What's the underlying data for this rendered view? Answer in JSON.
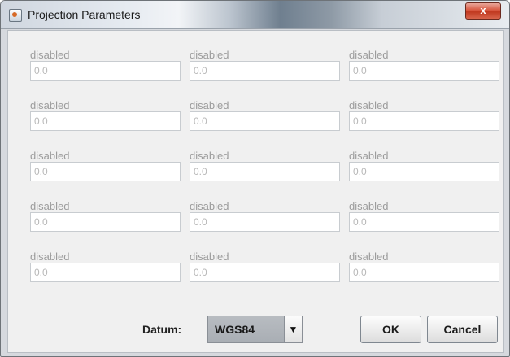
{
  "window": {
    "title": "Projection Parameters",
    "close_label": "x"
  },
  "fields": [
    {
      "label": "disabled",
      "value": "0.0"
    },
    {
      "label": "disabled",
      "value": "0.0"
    },
    {
      "label": "disabled",
      "value": "0.0"
    },
    {
      "label": "disabled",
      "value": "0.0"
    },
    {
      "label": "disabled",
      "value": "0.0"
    },
    {
      "label": "disabled",
      "value": "0.0"
    },
    {
      "label": "disabled",
      "value": "0.0"
    },
    {
      "label": "disabled",
      "value": "0.0"
    },
    {
      "label": "disabled",
      "value": "0.0"
    },
    {
      "label": "disabled",
      "value": "0.0"
    },
    {
      "label": "disabled",
      "value": "0.0"
    },
    {
      "label": "disabled",
      "value": "0.0"
    },
    {
      "label": "disabled",
      "value": "0.0"
    },
    {
      "label": "disabled",
      "value": "0.0"
    },
    {
      "label": "disabled",
      "value": "0.0"
    }
  ],
  "datum": {
    "label": "Datum:",
    "selected": "WGS84"
  },
  "buttons": {
    "ok": "OK",
    "cancel": "Cancel"
  }
}
